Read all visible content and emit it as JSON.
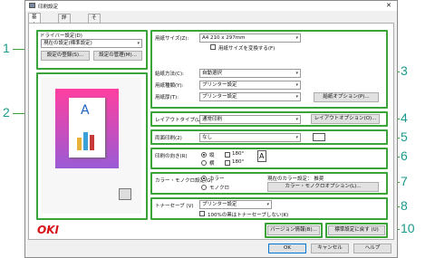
{
  "window": {
    "title": "印刷設定",
    "close_glyph": "✕"
  },
  "tabs": [
    {
      "label": "基本設定"
    },
    {
      "label": "詳細設定"
    },
    {
      "label": "その他設定"
    }
  ],
  "callouts": [
    "1",
    "2",
    "3",
    "4",
    "5",
    "6",
    "7",
    "8",
    "9",
    "10"
  ],
  "driver": {
    "group_label": "ドライバー設定(D)",
    "selected": "現在の設定(標準設定)",
    "register_button": "設定の登録(S)...",
    "manage_button": "設定の管理(M)..."
  },
  "preview": {
    "doc_letter": "A"
  },
  "brand": {
    "logo_text": "OKI",
    "color": "#d7141a"
  },
  "paper": {
    "size_label": "用紙サイズ(Z):",
    "size_value": "A4 210 x 297mm",
    "convert_label": "用紙サイズを変換する(F)",
    "feed_label": "給紙方法(C):",
    "feed_value": "自動選択",
    "type_label": "用紙種類(Y):",
    "type_value": "プリンター設定",
    "weight_label": "用紙厚(T):",
    "weight_value": "プリンター設定",
    "options_button": "給紙オプション(P)..."
  },
  "layout": {
    "label": "レイアウトタイプ(L)",
    "value": "通常印刷",
    "options_button": "レイアウトオプション(O)..."
  },
  "duplex": {
    "label": "両面印刷(2)",
    "value": "なし"
  },
  "orientation": {
    "label": "印刷の向き(R)",
    "portrait": "縦",
    "landscape": "横",
    "rotate1": "180°",
    "rotate2": "180°",
    "icon_letter": "A"
  },
  "color": {
    "label": "カラー・モノクロ設定(G)",
    "color_option": "カラー",
    "mono_option": "モノクロ",
    "current_text": "現在のカラー設定： 推奨",
    "options_button": "カラー・モノクロオプション(L)..."
  },
  "toner": {
    "label": "トナーセーブ (V)",
    "value": "プリンター設定",
    "black_label": "100%の黒はトナーセーブしない(K)"
  },
  "footer": {
    "version_button": "バージョン情報(B)...",
    "default_button": "標準設定に戻す (U)",
    "ok": "OK",
    "cancel": "キャンセル",
    "help": "ヘルプ"
  }
}
